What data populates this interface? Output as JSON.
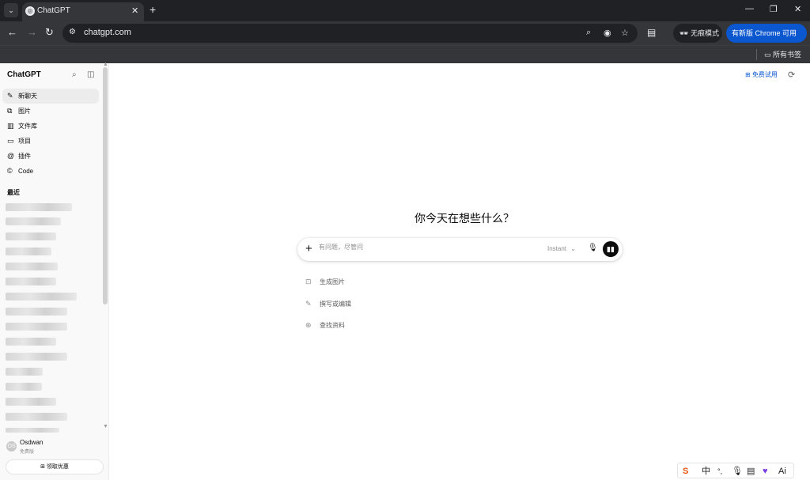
{
  "browser": {
    "tab_title": "ChatGPT",
    "address": "chatgpt.com",
    "incognito_label": "无痕模式",
    "update_label": "有新版 Chrome 可用",
    "bookmarks_label": "所有书签"
  },
  "sidebar": {
    "brand": "ChatGPT",
    "items": [
      {
        "label": "新聊天",
        "icon": "edit-icon"
      },
      {
        "label": "图片",
        "icon": "images-icon"
      },
      {
        "label": "文件库",
        "icon": "library-icon"
      },
      {
        "label": "项目",
        "icon": "folder-icon"
      },
      {
        "label": "插件",
        "icon": "at-icon"
      },
      {
        "label": "Code",
        "icon": "code-icon"
      }
    ],
    "recent_heading": "最近",
    "user": {
      "name": "Osdwan",
      "plan": "免费版",
      "initials": "OS"
    },
    "claim_label": "领取优惠"
  },
  "main": {
    "free_trial_label": "免费试用",
    "hero": "你今天在想些什么？",
    "composer": {
      "placeholder": "有问题，尽管问",
      "model": "Instant"
    },
    "suggestions": [
      {
        "label": "生成图片",
        "icon": "image-icon"
      },
      {
        "label": "撰写或编辑",
        "icon": "pencil-icon"
      },
      {
        "label": "查找资料",
        "icon": "globe-icon"
      }
    ]
  },
  "ime": {
    "lang": "中",
    "punct": "°,",
    "ai": "Ai"
  },
  "colors": {
    "accent_blue": "#0b57d0",
    "chrome_dark": "#202124",
    "chrome_toolbar": "#35363a",
    "sidebar_bg": "#f9f9f9"
  }
}
